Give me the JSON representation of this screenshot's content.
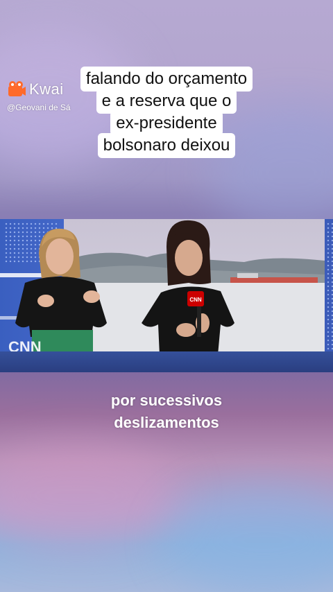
{
  "watermark": {
    "app_name": "Kwai",
    "user_handle": "@Geovani de Sá"
  },
  "caption": {
    "lines": [
      "falando do orçamento",
      "e a reserva que o",
      "ex-presidente",
      "bolsonaro deixou"
    ]
  },
  "video": {
    "mic_logo": "CNN",
    "studio_logo": "CNN"
  },
  "subtitle": {
    "lines": [
      "por sucessivos",
      "deslizamentos"
    ]
  },
  "colors": {
    "caption_bg": "#ffffff",
    "caption_text": "#111111",
    "cnn_red": "#cc0000",
    "studio_blue": "#3a5fc0"
  }
}
